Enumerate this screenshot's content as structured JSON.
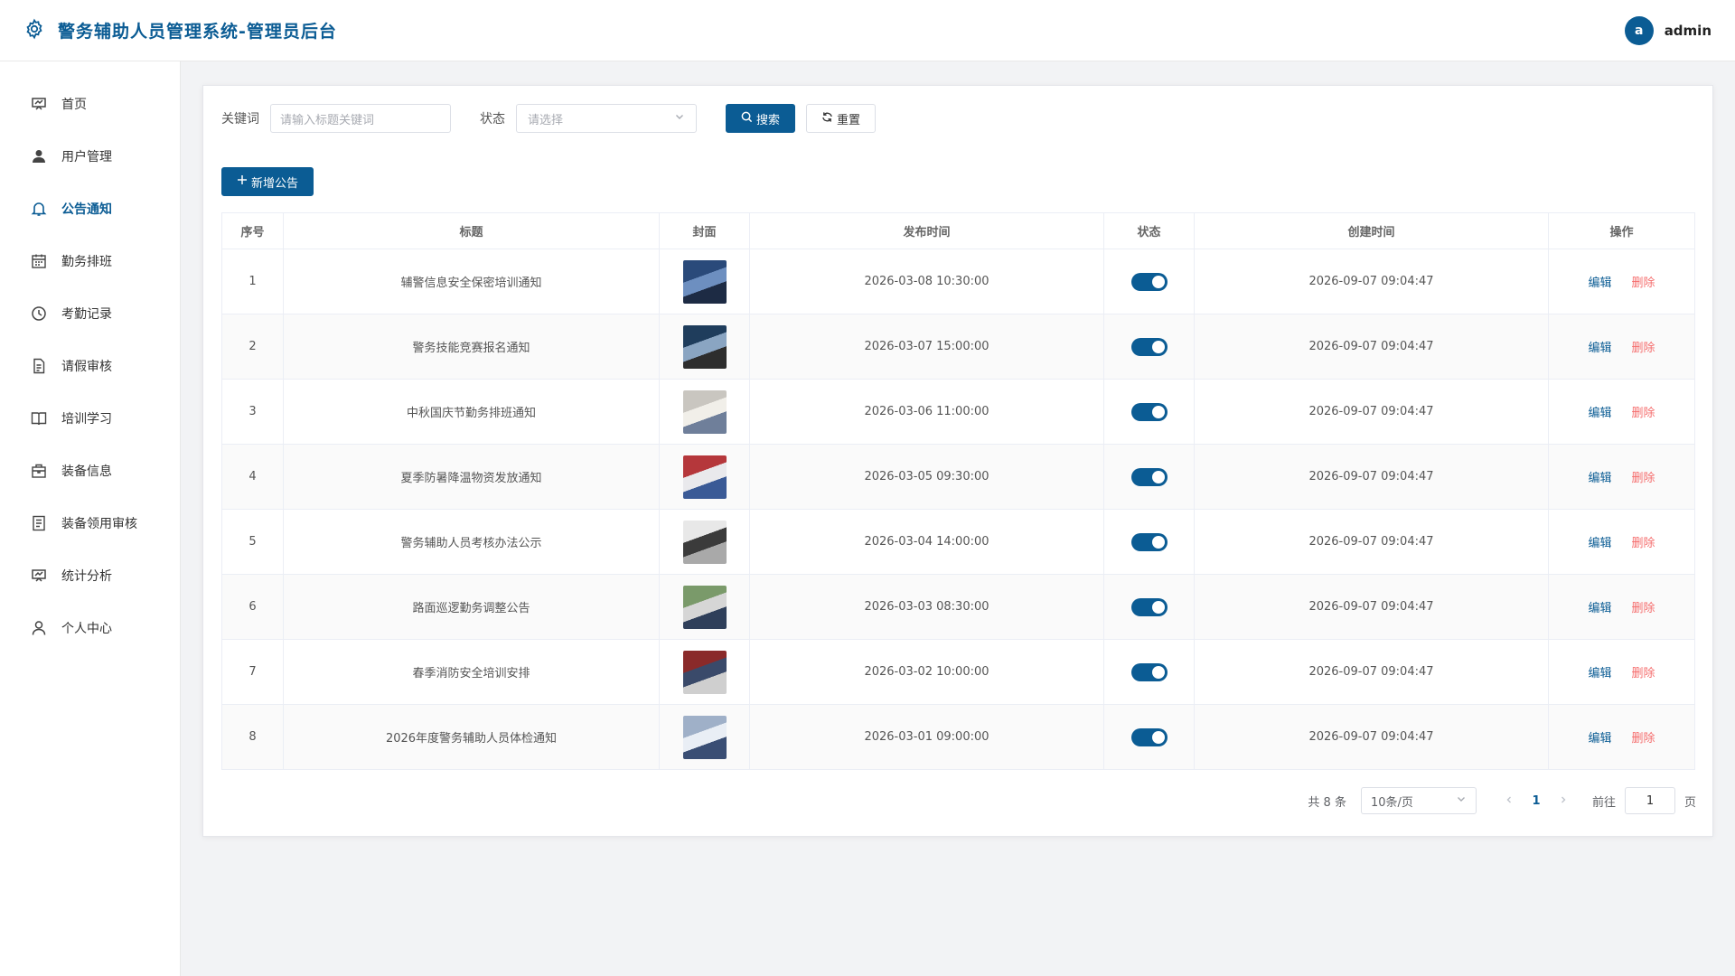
{
  "header": {
    "title": "警务辅助人员管理系统-管理员后台",
    "avatar_letter": "a",
    "username": "admin"
  },
  "sidebar": {
    "items": [
      {
        "label": "首页",
        "icon": "dashboard-icon"
      },
      {
        "label": "用户管理",
        "icon": "user-icon"
      },
      {
        "label": "公告通知",
        "icon": "bell-icon",
        "active": true
      },
      {
        "label": "勤务排班",
        "icon": "calendar-icon"
      },
      {
        "label": "考勤记录",
        "icon": "clock-icon"
      },
      {
        "label": "请假审核",
        "icon": "document-icon"
      },
      {
        "label": "培训学习",
        "icon": "book-icon"
      },
      {
        "label": "装备信息",
        "icon": "bag-icon"
      },
      {
        "label": "装备领用审核",
        "icon": "list-icon"
      },
      {
        "label": "统计分析",
        "icon": "chart-icon"
      },
      {
        "label": "个人中心",
        "icon": "person-icon"
      }
    ]
  },
  "filter": {
    "keyword_label": "关键词",
    "keyword_placeholder": "请输入标题关键词",
    "status_label": "状态",
    "status_placeholder": "请选择",
    "search_label": "搜索",
    "reset_label": "重置"
  },
  "add_button_label": "新增公告",
  "table": {
    "headers": [
      "序号",
      "标题",
      "封面",
      "发布时间",
      "状态",
      "创建时间",
      "操作"
    ],
    "edit_label": "编辑",
    "delete_label": "删除",
    "rows": [
      {
        "no": "1",
        "title": "辅警信息安全保密培训通知",
        "publish": "2026-03-08 10:30:00",
        "status": true,
        "created": "2026-09-07 09:04:47"
      },
      {
        "no": "2",
        "title": "警务技能竞赛报名通知",
        "publish": "2026-03-07 15:00:00",
        "status": true,
        "created": "2026-09-07 09:04:47"
      },
      {
        "no": "3",
        "title": "中秋国庆节勤务排班通知",
        "publish": "2026-03-06 11:00:00",
        "status": true,
        "created": "2026-09-07 09:04:47"
      },
      {
        "no": "4",
        "title": "夏季防暑降温物资发放通知",
        "publish": "2026-03-05 09:30:00",
        "status": true,
        "created": "2026-09-07 09:04:47"
      },
      {
        "no": "5",
        "title": "警务辅助人员考核办法公示",
        "publish": "2026-03-04 14:00:00",
        "status": true,
        "created": "2026-09-07 09:04:47"
      },
      {
        "no": "6",
        "title": "路面巡逻勤务调整公告",
        "publish": "2026-03-03 08:30:00",
        "status": true,
        "created": "2026-09-07 09:04:47"
      },
      {
        "no": "7",
        "title": "春季消防安全培训安排",
        "publish": "2026-03-02 10:00:00",
        "status": true,
        "created": "2026-09-07 09:04:47"
      },
      {
        "no": "8",
        "title": "2026年度警务辅助人员体检通知",
        "publish": "2026-03-01 09:00:00",
        "status": true,
        "created": "2026-09-07 09:04:47"
      }
    ]
  },
  "pagination": {
    "total_text": "共 8 条",
    "page_size": "10条/页",
    "current_page": "1",
    "goto_label": "前往",
    "goto_value": "1",
    "page_suffix": "页"
  },
  "colors": {
    "accent": "#0b5c94",
    "danger": "#f56c6c"
  }
}
